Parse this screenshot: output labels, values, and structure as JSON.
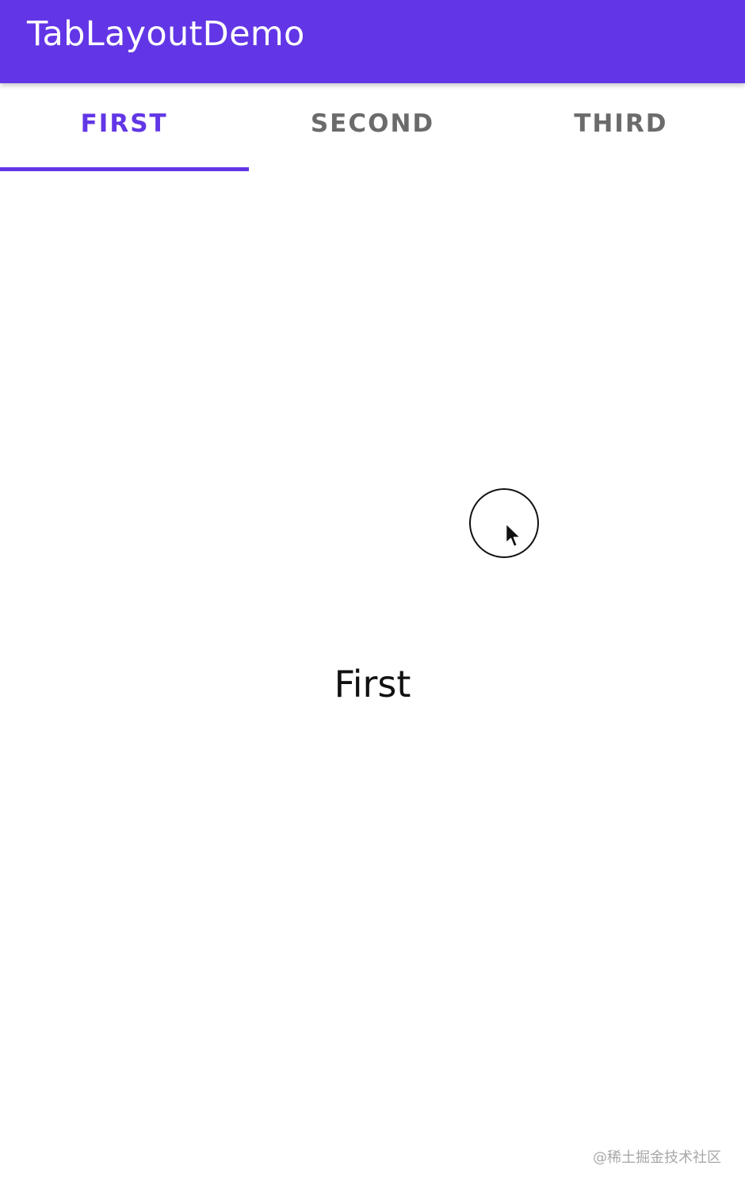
{
  "app_bar": {
    "title": "TabLayoutDemo",
    "background_color": "#6236e6"
  },
  "tabs": [
    {
      "label": "FIRST",
      "selected": true
    },
    {
      "label": "SECOND",
      "selected": false
    },
    {
      "label": "THIRD",
      "selected": false
    }
  ],
  "colors": {
    "accent": "#6236e6",
    "tab_inactive_text": "#6b6b6b",
    "content_text": "#111111"
  },
  "content": {
    "text": "First"
  },
  "overlay": {
    "touch_indicator": "circle-with-cursor",
    "cursor_icon": "arrow-cursor-icon"
  },
  "watermark": {
    "text": "@稀土掘金技术社区"
  }
}
